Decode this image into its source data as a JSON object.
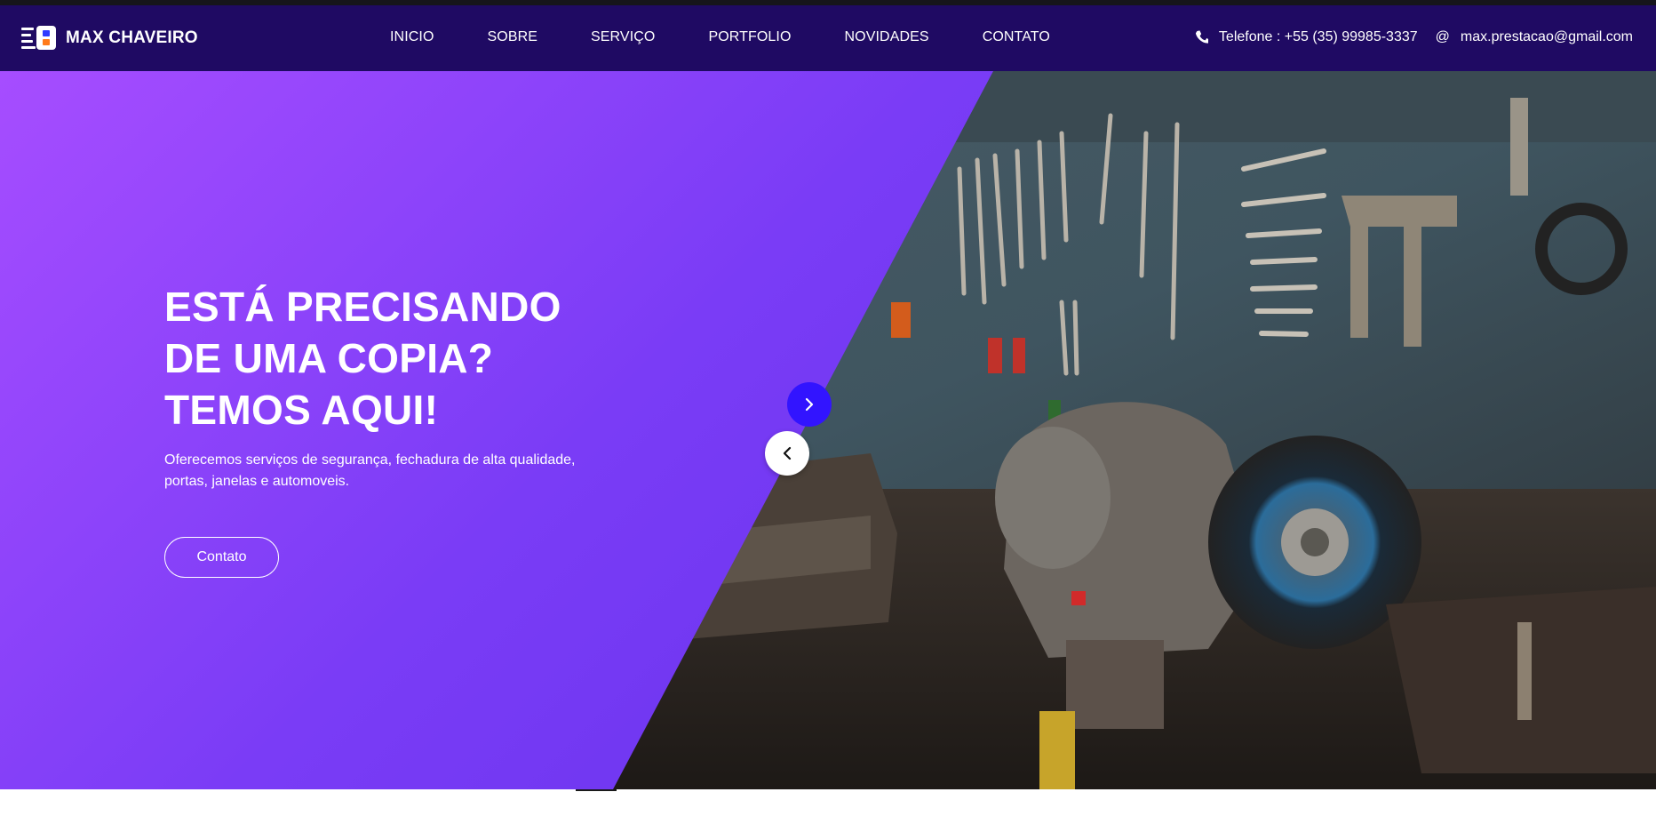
{
  "brand": {
    "name": "MAX CHAVEIRO"
  },
  "nav": {
    "items": [
      {
        "label": "INICIO"
      },
      {
        "label": "SOBRE"
      },
      {
        "label": "SERVIÇO"
      },
      {
        "label": "PORTFOLIO"
      },
      {
        "label": "NOVIDADES"
      },
      {
        "label": "CONTATO"
      }
    ]
  },
  "contact": {
    "phone": "Telefone : +55 (35) 99985-3337",
    "email_symbol": "@",
    "email": "max.prestacao@gmail.com"
  },
  "hero": {
    "title_line1": "ESTÁ PRECISANDO",
    "title_line2": "DE UMA COPIA?",
    "title_line3": "TEMOS AQUI!",
    "subtitle": "Oferecemos serviços de segurança, fechadura de alta qualidade, portas, janelas e automoveis.",
    "button_label": "Contato"
  },
  "colors": {
    "navbar": "#1f0a63",
    "hero_gradient_start": "#a64dff",
    "hero_gradient_end": "#5a2ce6",
    "arrow_next": "#3214ff"
  },
  "icons": {
    "phone": "phone-icon",
    "logo": "logo-icon",
    "next": "chevron-right-icon",
    "prev": "chevron-left-icon"
  }
}
